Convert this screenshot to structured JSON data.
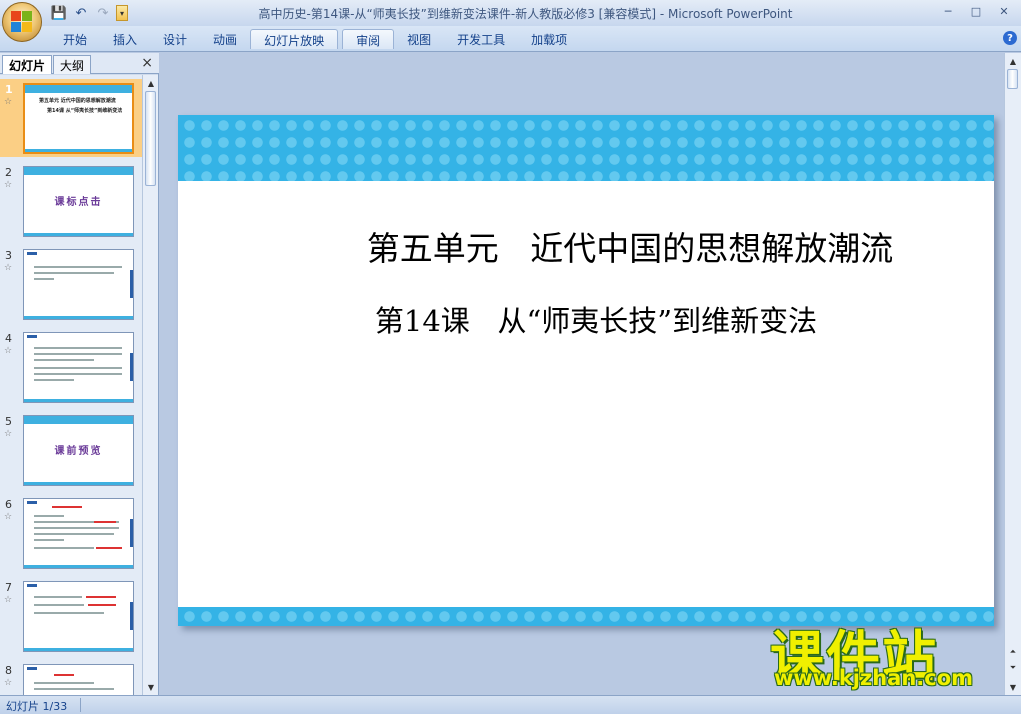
{
  "app": {
    "window_title": "高中历史-第14课-从“师夷长技”到维新变法课件-新人教版必修3 [兼容模式] - Microsoft PowerPoint"
  },
  "quick_access": {
    "icons": [
      "save-icon",
      "undo-icon",
      "redo-icon",
      "customize-dropdown-icon"
    ]
  },
  "ribbon": {
    "tabs": [
      {
        "label": "开始"
      },
      {
        "label": "插入"
      },
      {
        "label": "设计"
      },
      {
        "label": "动画"
      },
      {
        "label": "幻灯片放映"
      },
      {
        "label": "审阅"
      },
      {
        "label": "视图"
      },
      {
        "label": "开发工具"
      },
      {
        "label": "加载项"
      }
    ],
    "active_tab": "幻灯片放映"
  },
  "panel": {
    "tabs": [
      {
        "label": "幻灯片"
      },
      {
        "label": "大纲"
      }
    ],
    "close": "×"
  },
  "thumbnails": [
    {
      "num": "1",
      "title_line1": "第五单元  近代中国的思想解放潮流",
      "title_line2": "第14课  从“师夷长技”到维新变法"
    },
    {
      "num": "2",
      "title": "课标点击"
    },
    {
      "num": "3"
    },
    {
      "num": "4"
    },
    {
      "num": "5",
      "title": "课前预览"
    },
    {
      "num": "6"
    },
    {
      "num": "7"
    },
    {
      "num": "8"
    }
  ],
  "slide": {
    "title": "第五单元   近代中国的思想解放潮流",
    "subtitle": "第14课   从“师夷长技”到维新变法"
  },
  "watermark": {
    "text": "课件站",
    "url": "www.kjzhan.com"
  },
  "status": {
    "slide_indicator": "幻灯片 1/33"
  },
  "colors": {
    "slide_band": "#34b3e6",
    "selected_thumb": "#fbcf85",
    "watermark": "#f0f000"
  }
}
